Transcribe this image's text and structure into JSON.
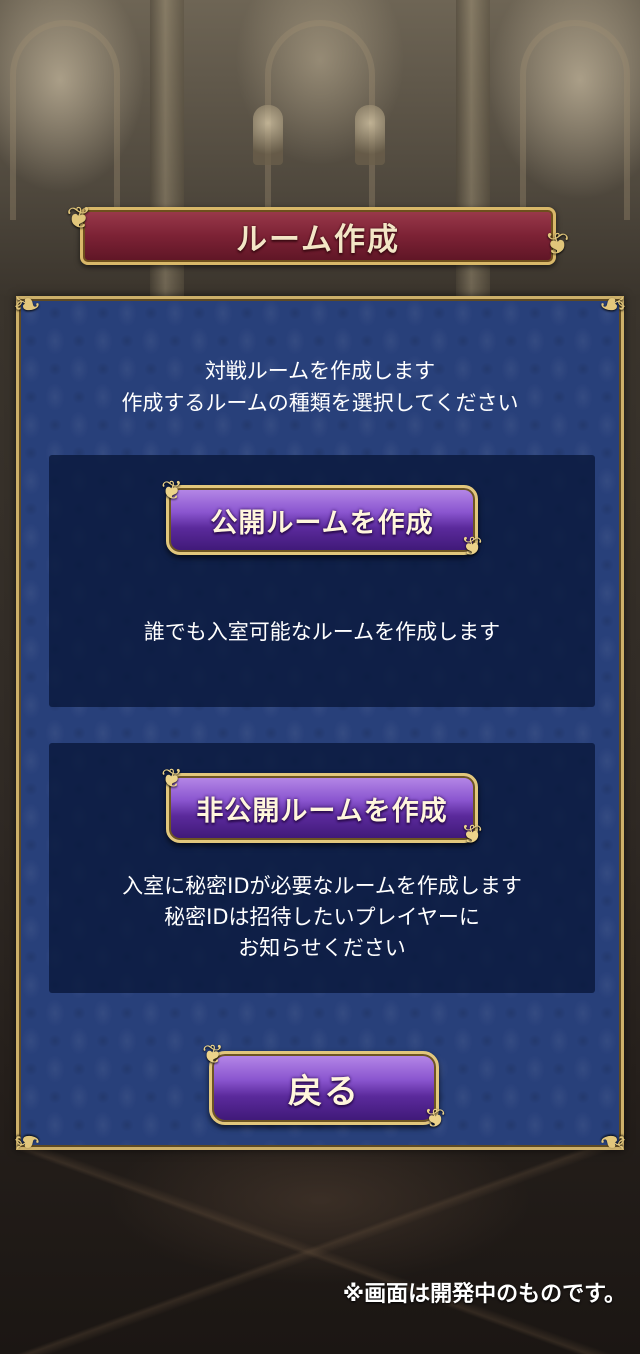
{
  "title": "ルーム作成",
  "intro_lines": [
    "対戦ルームを作成します",
    "作成するルームの種類を選択してください"
  ],
  "public_room": {
    "button_label": "公開ルームを作成",
    "description": "誰でも入室可能なルームを作成します"
  },
  "private_room": {
    "button_label": "非公開ルームを作成",
    "description_lines": [
      "入室に秘密IDが必要なルームを作成します",
      "秘密IDは招待したいプレイヤーに",
      "お知らせください"
    ]
  },
  "back_label": "戻る",
  "dev_note": "※画面は開発中のものです。",
  "colors": {
    "panel_blue": "#28407a",
    "banner_red": "#7c2235",
    "button_purple": "#8a55cf",
    "gold_frame": "#d9b869"
  },
  "icons": [
    "gold-flourish-icon",
    "corner-ornament-icon"
  ]
}
